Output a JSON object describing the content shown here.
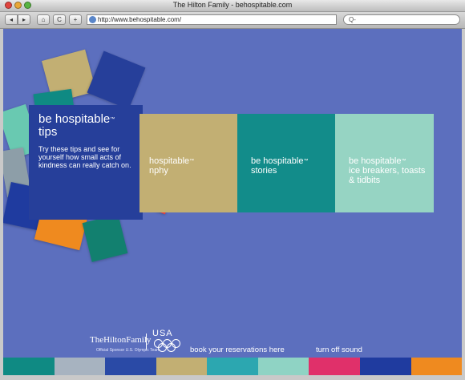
{
  "window": {
    "title": "The Hilton Family - behospitable.com"
  },
  "toolbar": {
    "back_glyph": "◂",
    "forward_glyph": "▸",
    "home_glyph": "⌂",
    "reload_glyph": "C",
    "add_glyph": "+",
    "url": "http://www.behospitable.com/",
    "search_placeholder": "Q-"
  },
  "main_card": {
    "title_line1": "be hospitable",
    "tm": "™",
    "title_line2": "tips",
    "body": "Try these tips and see for yourself how small acts of kindness can really catch on."
  },
  "panels": [
    {
      "line1": "hospitable",
      "tm": "™",
      "line2": "nphy"
    },
    {
      "line1": "be hospitable",
      "tm": "™",
      "line2": "stories"
    },
    {
      "line1": "be hospitable",
      "tm": "™",
      "line2": "ice breakers, toasts & tidbits"
    }
  ],
  "footer": {
    "logo": "TheHiltonFamily",
    "logo_sub": "Official Sponsor U.S. Olympic Team",
    "usa": "USA",
    "reservations_link": "book your reservations here",
    "sound_link": "turn off sound"
  },
  "colors": {
    "background": "#5c6fbe",
    "main_card": "#263f9a",
    "panel_philosophy": "#c2af73",
    "panel_stories": "#128c8a",
    "panel_icebreakers": "#96d4c3",
    "stripes": [
      "#0f8a83",
      "#a7b3c0",
      "#2a4aa6",
      "#c2af73",
      "#2ca7b0",
      "#8fd3c4",
      "#e0306a",
      "#1f3b9f",
      "#ef8a1f"
    ]
  }
}
